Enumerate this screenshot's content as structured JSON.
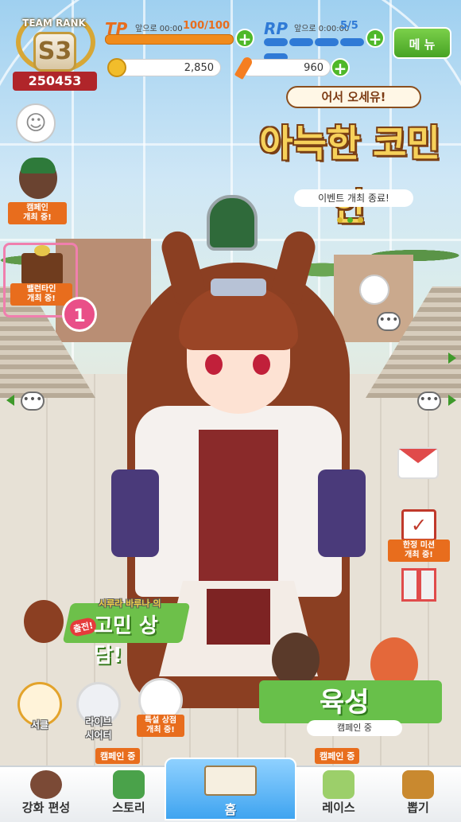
{
  "hud": {
    "team_rank_label": "TEAM RANK",
    "rank_grade": "S3",
    "rank_score": "250453",
    "tp": {
      "label": "TP",
      "timer_text": "앞으로 00:00",
      "value": "100/100",
      "fill": 1.0
    },
    "rp": {
      "label": "RP",
      "timer_text": "앞으로 0:00:00",
      "value": "5/5",
      "pips_filled": 5,
      "pips_total": 5
    },
    "money": "2,850",
    "carrots": "960",
    "menu_label": "메 뉴"
  },
  "left_panel": {
    "campaign_label": "캠페인\n개최 중!",
    "valentine_label": "밸런타인\n개최 중!",
    "notification_count": "1"
  },
  "event_banner": {
    "top_text": "어서 오세유!",
    "main_title": "아늑한 코민안",
    "status": "이벤트 개최 종료!",
    "page_dots": 3,
    "active_dot": 2
  },
  "right_panel": {
    "mission_label": "한정 미션\n개최 중!"
  },
  "consult_banner": {
    "tag": "출전!",
    "subtitle": "시루라 바루나 의",
    "title": "고민 상담!"
  },
  "mini_buttons": {
    "circle_label": "서클",
    "live_theater_label": "라이브\n시어터",
    "shop_label": "특설 상점\n개최 중!"
  },
  "training": {
    "title": "육성",
    "sub": "캠페인 중"
  },
  "nav": {
    "tag_story": "캠페인 중",
    "tag_race": "캠페인 중",
    "items": [
      {
        "label": "강화 편성"
      },
      {
        "label": "스토리"
      },
      {
        "label": "홈"
      },
      {
        "label": "레이스"
      },
      {
        "label": "뽑기"
      }
    ]
  },
  "colors": {
    "tp_bar": "#f08b1c",
    "rp_pip": "#2f7ad6",
    "menu_green": "#47a324",
    "notification_pink": "#e94f88",
    "home_blue": "#3fa4f0"
  }
}
